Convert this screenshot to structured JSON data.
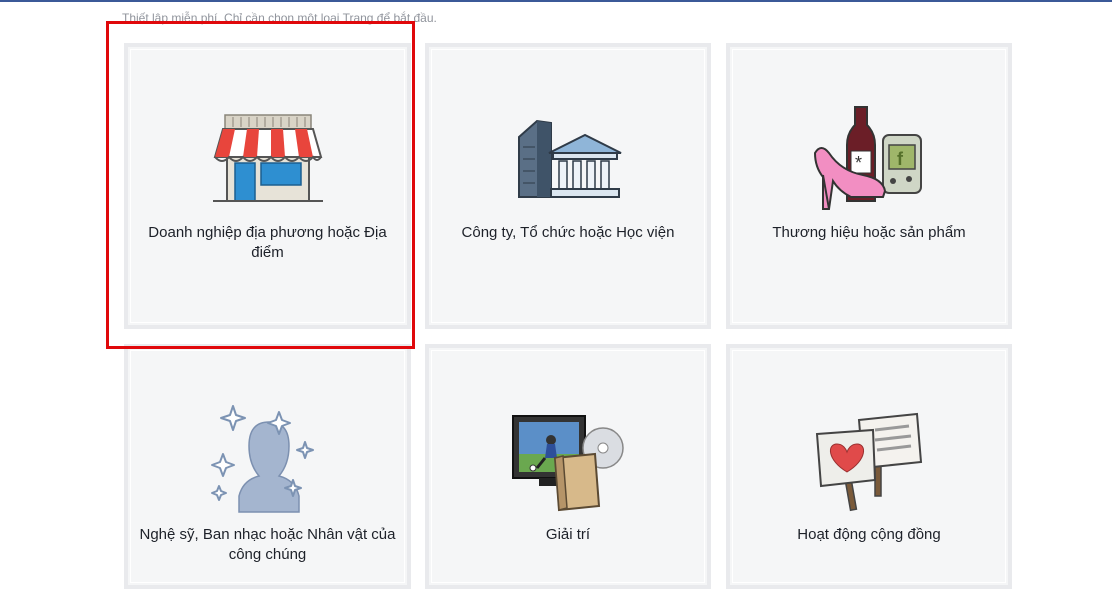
{
  "header": {
    "subtitle": "Thiết lập miễn phí. Chỉ cần chọn một loại Trang để bắt đầu."
  },
  "categories": [
    {
      "label": "Doanh nghiệp địa phương hoặc Địa điểm",
      "icon": "storefront-icon"
    },
    {
      "label": "Công ty, Tổ chức hoặc Học viện",
      "icon": "company-building-icon"
    },
    {
      "label": "Thương hiệu hoặc sản phẩm",
      "icon": "brand-product-icon"
    },
    {
      "label": "Nghệ sỹ, Ban nhạc hoặc Nhân vật của công chúng",
      "icon": "artist-silhouette-icon"
    },
    {
      "label": "Giải trí",
      "icon": "entertainment-icon"
    },
    {
      "label": "Hoạt động cộng đồng",
      "icon": "community-signs-icon"
    }
  ],
  "colors": {
    "accent": "#3b5998",
    "highlight": "#e0080b",
    "card_bg": "#f5f6f7",
    "card_border": "#e9eaed"
  }
}
